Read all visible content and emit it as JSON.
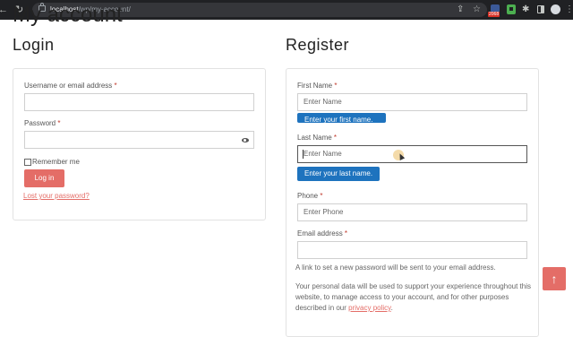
{
  "browser": {
    "back_icon": "←",
    "forward_icon": "→",
    "reload_icon": "↻",
    "url_host": "localhost",
    "url_path": "/wp/my-account/",
    "share_icon": "⇪",
    "star_icon": "☆",
    "extension_badge": "2068",
    "puzzle_icon": "✱",
    "menu_icon": "⋮"
  },
  "page": {
    "title": "My account"
  },
  "login": {
    "heading": "Login",
    "username_label": "Username or email address",
    "password_label": "Password",
    "required_marker": "*",
    "remember_label": "Remember me",
    "button_label": "Log in",
    "lost_password": "Lost your password?"
  },
  "register": {
    "heading": "Register",
    "first_name_label": "First Name",
    "first_name_placeholder": "Enter Name",
    "first_name_tip": "Enter your first name.",
    "last_name_label": "Last Name",
    "last_name_placeholder": "Enter Name",
    "last_name_tip": "Enter your last name.",
    "phone_label": "Phone",
    "phone_placeholder": "Enter Phone",
    "email_label": "Email address",
    "required_marker": "*",
    "password_note": "A link to set a new password will be sent to your email address.",
    "privacy_text": "Your personal data will be used to support your experience throughout this website, to manage access to your account, and for other purposes described in our",
    "privacy_link": "privacy policy",
    "privacy_end": "."
  },
  "scroll_top": {
    "icon": "↑"
  },
  "colors": {
    "accent": "#e46d67",
    "tooltip": "#1e73be"
  }
}
